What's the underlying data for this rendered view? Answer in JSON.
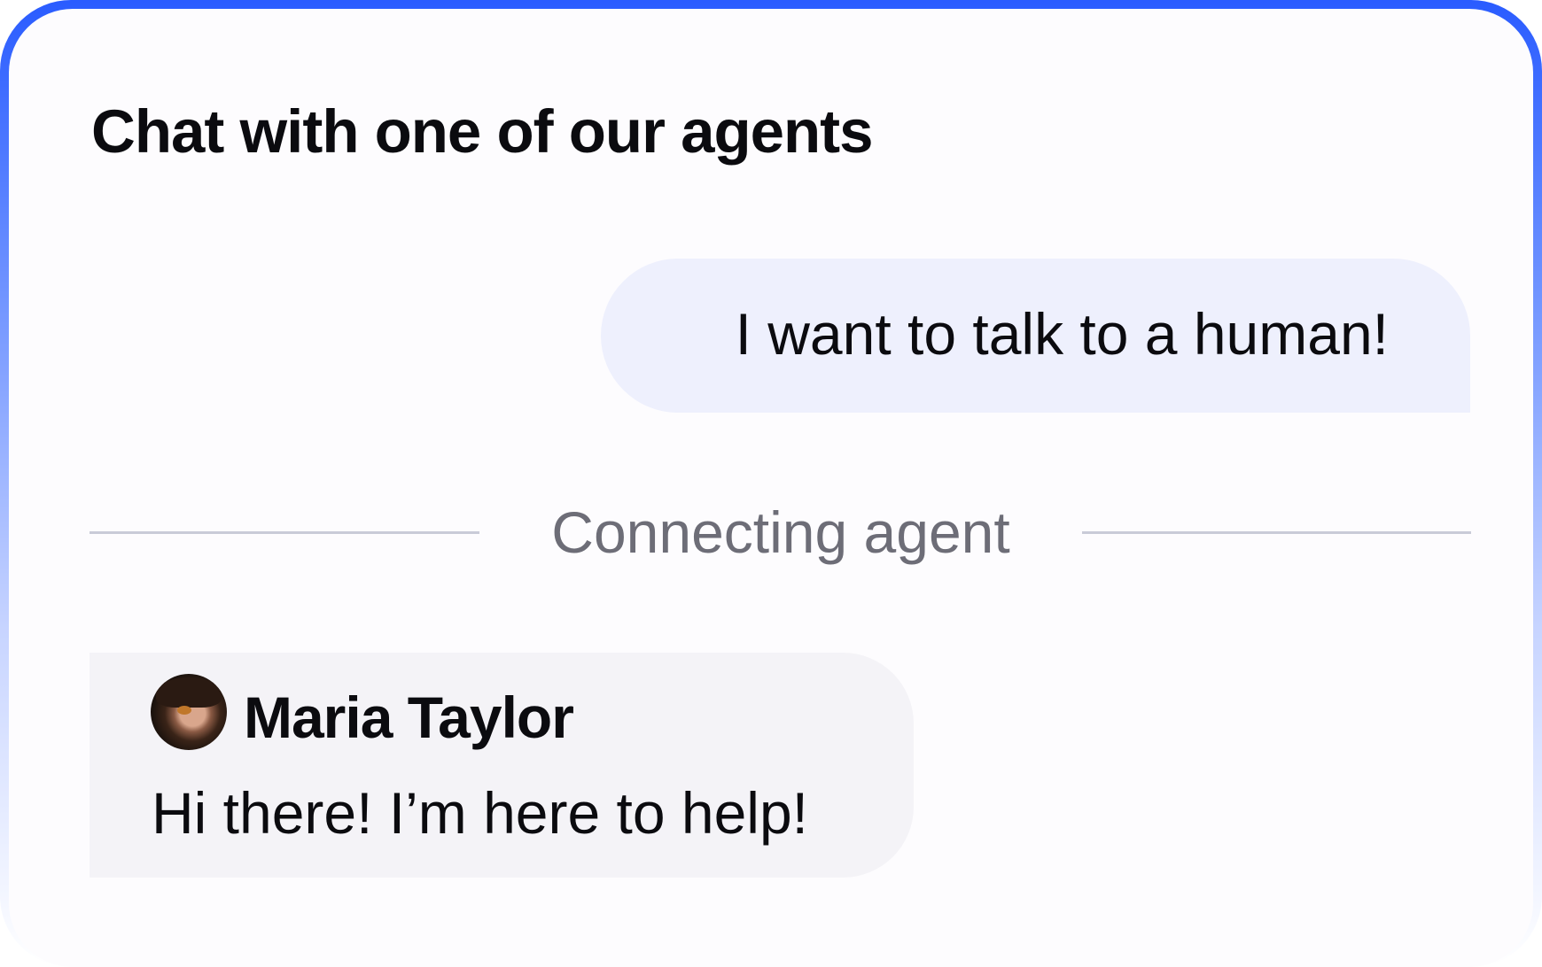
{
  "header": {
    "title": "Chat with one of our agents"
  },
  "messages": {
    "user": {
      "text": "I want to talk to a human!"
    },
    "status": {
      "label": "Connecting agent"
    },
    "agent": {
      "name": "Maria Taylor",
      "text": "Hi there! I’m here to help!"
    }
  },
  "colors": {
    "accent_border": "#2a5cff",
    "user_bubble": "#eef0fd",
    "agent_bubble": "#f4f3f7",
    "divider": "#c9cbd8",
    "status_text": "#6d6d77"
  }
}
